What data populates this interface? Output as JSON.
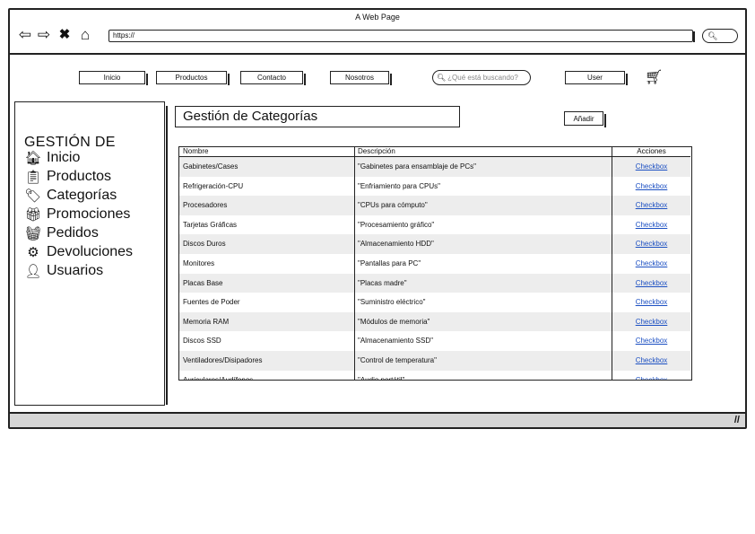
{
  "browser": {
    "title": "A Web Page",
    "url": "https://",
    "icons": [
      "back-arrow-icon",
      "forward-arrow-icon",
      "close-x-icon",
      "home-icon",
      "search-icon"
    ]
  },
  "topnav": {
    "inicio": "Inicio",
    "productos": "Productos",
    "contacto": "Contacto",
    "nosotros": "Nosotros",
    "search_placeholder": "¿Qué está buscando?",
    "user": "User",
    "cart_icon": "shopping-cart-icon"
  },
  "sidebar": {
    "title": "GESTIÓN DE",
    "items": [
      {
        "label": "Inicio",
        "icon": "home-icon"
      },
      {
        "label": "Productos",
        "icon": "clipboard-icon"
      },
      {
        "label": "Categorías",
        "icon": "tag-icon"
      },
      {
        "label": "Promociones",
        "icon": "gift-icon"
      },
      {
        "label": "Pedidos",
        "icon": "shopping-basket-icon"
      },
      {
        "label": "Devoluciones",
        "icon": "cog-icon"
      },
      {
        "label": "Usuarios",
        "icon": "user-icon"
      }
    ]
  },
  "main": {
    "title": "Gestión de Categorías",
    "add_button": "Añadir"
  },
  "table": {
    "headers": [
      "Nombre",
      "Descripción",
      "Acciones"
    ],
    "rows": [
      [
        "Gabinetes/Cases",
        "\"Gabinetes para ensamblaje de PCs\"",
        "Checkbox"
      ],
      [
        "Refrigeración-CPU",
        "\"Enfriamiento para CPUs\"",
        "Checkbox"
      ],
      [
        "Procesadores",
        "\"CPUs para cómputo\"",
        "Checkbox"
      ],
      [
        "Tarjetas Gráficas",
        "\"Procesamiento gráfico\"",
        "Checkbox"
      ],
      [
        "Discos Duros",
        "\"Almacenamiento HDD\"",
        "Checkbox"
      ],
      [
        "Monitores",
        "\"Pantallas para PC\"",
        "Checkbox"
      ],
      [
        "Placas Base",
        "\"Placas madre\"",
        "Checkbox"
      ],
      [
        "Fuentes de Poder",
        "\"Suministro eléctrico\"",
        "Checkbox"
      ],
      [
        "Memoria RAM",
        "\"Módulos de memoria\"",
        "Checkbox"
      ],
      [
        "Discos SSD",
        "\"Almacenamiento SSD\"",
        "Checkbox"
      ],
      [
        "Ventiladores/Disipadores",
        "\"Control de temperatura\"",
        "Checkbox"
      ],
      [
        "Auriculares/Audífonos",
        "\"Audio portátil\"",
        "Checkbox"
      ]
    ]
  }
}
